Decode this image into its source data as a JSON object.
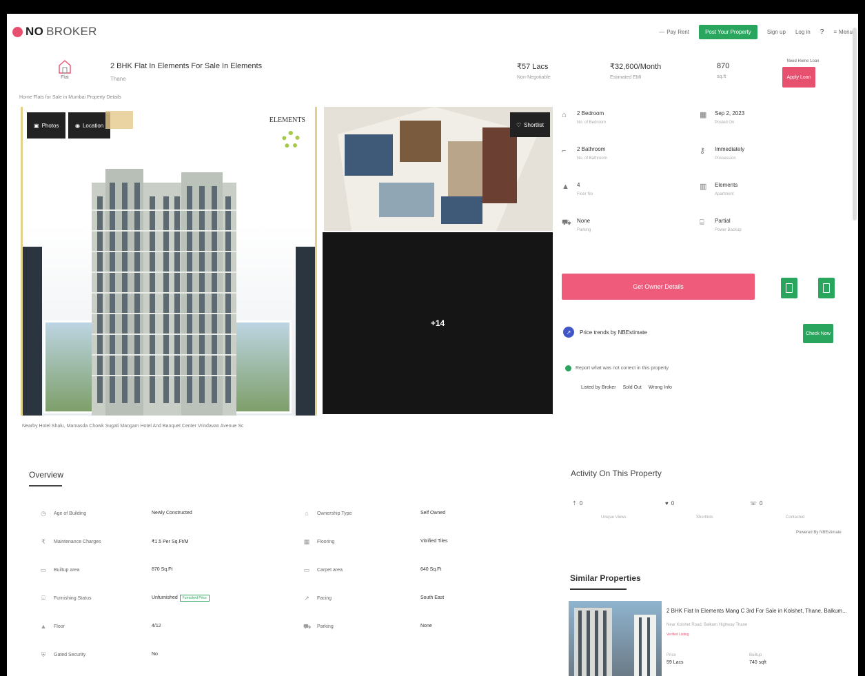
{
  "brand": {
    "name_bold": "NO",
    "name_light": "BROKER",
    "color": "#e8506f"
  },
  "nav": {
    "pay_rent": "Pay Rent",
    "post_property": "Post Your Property",
    "sign_up": "Sign up",
    "log_in": "Log in",
    "help": "?",
    "menu": "Menu"
  },
  "property": {
    "type_label": "Flat",
    "title": "2 BHK Flat In Elements For Sale In Elements",
    "subtitle": "Thane",
    "price": "₹57 Lacs",
    "price_sub": "Non-Negotiable",
    "emi": "₹32,600/Month",
    "emi_sub": "Estimated EMI",
    "area": "870",
    "area_sub": "sq.ft",
    "report_label": "Need Home Loan",
    "report_btn": "Apply Loan"
  },
  "breadcrumb": "Home  Flats for Sale in Mumbai  Property Details",
  "gallery": {
    "photos_btn": "Photos",
    "location_btn": "Location",
    "brand_name": "ELEMENTS",
    "shortlist": "Shortlist",
    "more_count": "+14"
  },
  "landmarks": "Nearby  Hotel Shalu, Mamasda Chowk   Sugati   Mangam Hotel And Banquet Center   Vrindavan Avenue Sc",
  "details": [
    {
      "icon": "bed-icon",
      "glyph": "⌂",
      "value": "2 Bedroom",
      "sub": "No. of Bedroom"
    },
    {
      "icon": "calendar-icon",
      "glyph": "▦",
      "value": "Sep 2, 2023",
      "sub": "Posted On"
    },
    {
      "icon": "bath-icon",
      "glyph": "⌐",
      "value": "2 Bathroom",
      "sub": "No. of Bathroom"
    },
    {
      "icon": "key-icon",
      "glyph": "⚷",
      "value": "Immediately",
      "sub": "Possession"
    },
    {
      "icon": "floor-icon",
      "glyph": "▲",
      "value": "4",
      "sub": "Floor No"
    },
    {
      "icon": "building-icon",
      "glyph": "▥",
      "value": "Elements",
      "sub": "Apartment"
    },
    {
      "icon": "car-icon",
      "glyph": "⛟",
      "value": "None",
      "sub": "Parking"
    },
    {
      "icon": "sofa-icon",
      "glyph": "⌸",
      "value": "Partial",
      "sub": "Power Backup"
    }
  ],
  "actions": {
    "owner_btn": "Get Owner Details",
    "trend": "Price trends by NBEstimate",
    "check_btn": "Check Now",
    "report_q": "Report what was not correct in this property",
    "report_opts": [
      "Listed by Broker",
      "Sold Out",
      "Wrong Info"
    ]
  },
  "overview": {
    "title": "Overview",
    "rows": [
      {
        "icon": "age-icon",
        "label": "Age of Building",
        "value": "Newly Constructed"
      },
      {
        "icon": "ownership-icon",
        "label": "Ownership Type",
        "value": "Self Owned"
      },
      {
        "icon": "maintenance-icon",
        "label": "Maintenance Charges",
        "value": "₹1.5 Per Sq.Ft/M"
      },
      {
        "icon": "flooring-icon",
        "label": "Flooring",
        "value": "Vitrified Tiles"
      },
      {
        "icon": "builtup-icon",
        "label": "Builtup area",
        "value": "870 Sq.Ft"
      },
      {
        "icon": "carpet-icon",
        "label": "Carpet area",
        "value": "640 Sq.Ft"
      },
      {
        "icon": "furnishing-icon",
        "label": "Furnishing Status",
        "value": "Unfurnished",
        "badge": "Furnished Price"
      },
      {
        "icon": "facing-icon",
        "label": "Facing",
        "value": "South East"
      },
      {
        "icon": "floor-icon",
        "label": "Floor",
        "value": "4/12"
      },
      {
        "icon": "parking-icon",
        "label": "Parking",
        "value": "None"
      },
      {
        "icon": "gate-icon",
        "label": "Gated Security",
        "value": "No"
      }
    ]
  },
  "activity": {
    "title": "Activity On This Property",
    "items": [
      {
        "icon": "views-icon",
        "value": "0",
        "sub": "Unique Views"
      },
      {
        "icon": "shortlist-icon",
        "value": "0",
        "sub": "Shortlists"
      },
      {
        "icon": "contact-icon",
        "value": "0",
        "sub": "Contacted"
      }
    ],
    "powered": "Powered By  NBEstimate"
  },
  "similar": {
    "title": "Similar Properties",
    "card": {
      "title": "2 BHK Flat In Elements Mang C 3rd For Sale in Kolshet, Thane, Balkum...",
      "sub": "Near Kolshet Road, Balkum Highway Thane",
      "tag": "Verified Listing",
      "price_label": "Price",
      "price": "59 Lacs",
      "area_label": "Builtup",
      "area": "740 sqft"
    }
  },
  "colors": {
    "accent_pink": "#e8506f",
    "accent_green": "#2aa55e"
  }
}
